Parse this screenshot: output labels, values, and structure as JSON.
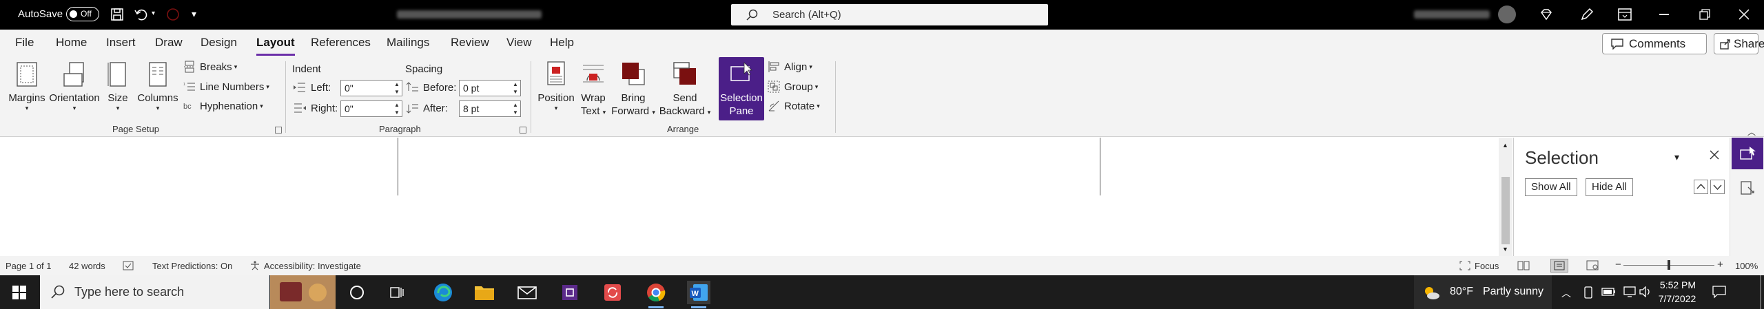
{
  "title_bar": {
    "autosave_label": "AutoSave",
    "autosave_state": "Off",
    "search_placeholder": "Search (Alt+Q)"
  },
  "menu": {
    "tabs": [
      "File",
      "Home",
      "Insert",
      "Draw",
      "Design",
      "Layout",
      "References",
      "Mailings",
      "Review",
      "View",
      "Help"
    ],
    "active_tab": "Layout",
    "comments_label": "Comments",
    "share_label": "Share"
  },
  "ribbon": {
    "page_setup": {
      "margins": "Margins",
      "orientation": "Orientation",
      "size": "Size",
      "columns": "Columns",
      "breaks": "Breaks",
      "line_numbers": "Line Numbers",
      "hyphenation": "Hyphenation",
      "group_label": "Page Setup"
    },
    "paragraph": {
      "indent_label": "Indent",
      "spacing_label": "Spacing",
      "left_label": "Left:",
      "left_value": "0\"",
      "right_label": "Right:",
      "right_value": "0\"",
      "before_label": "Before:",
      "before_value": "0 pt",
      "after_label": "After:",
      "after_value": "8 pt",
      "group_label": "Paragraph"
    },
    "arrange": {
      "position": "Position",
      "wrap_text_1": "Wrap",
      "wrap_text_2": "Text",
      "bring_forward_1": "Bring",
      "bring_forward_2": "Forward",
      "send_backward_1": "Send",
      "send_backward_2": "Backward",
      "selection_pane_1": "Selection",
      "selection_pane_2": "Pane",
      "align": "Align",
      "group": "Group",
      "rotate": "Rotate",
      "group_label": "Arrange"
    }
  },
  "selection_pane": {
    "title": "Selection",
    "show_all": "Show All",
    "hide_all": "Hide All"
  },
  "status_bar": {
    "page": "Page 1 of 1",
    "words": "42 words",
    "text_predictions": "Text Predictions: On",
    "accessibility": "Accessibility: Investigate",
    "focus": "Focus",
    "zoom": "100%",
    "zoom_level": 1.0
  },
  "taskbar": {
    "search_placeholder": "Type here to search",
    "weather_temp": "80°F",
    "weather_text": "Partly sunny",
    "time": "5:52 PM",
    "date": "7/7/2022"
  },
  "colors": {
    "accent": "#4b1f88",
    "word_blue": "#2b579a",
    "dark_red": "#7a1010"
  }
}
